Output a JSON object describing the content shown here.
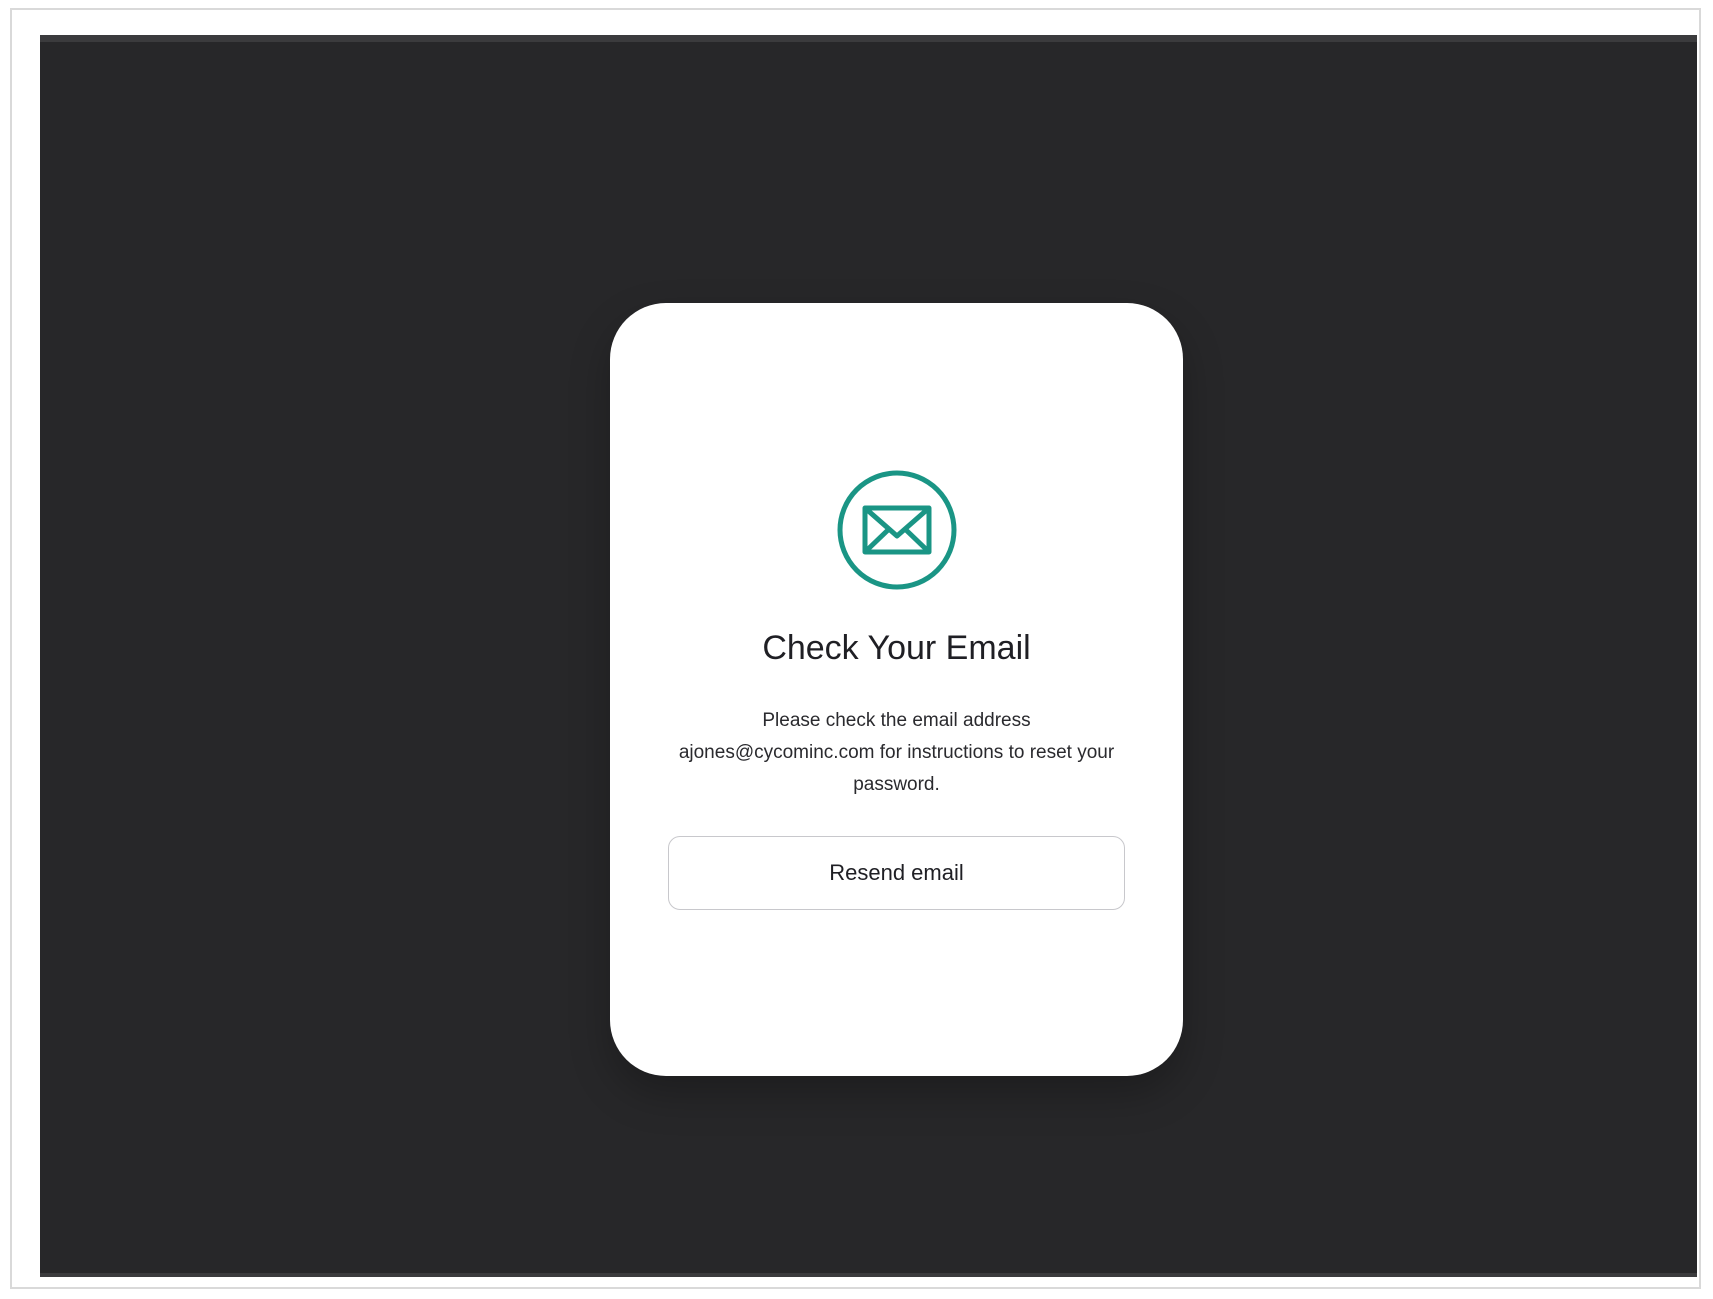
{
  "card": {
    "icon": "envelope-icon",
    "title": "Check Your Email",
    "message": "Please check the email address ajones@cycominc.com for instructions to reset your password.",
    "resend_label": "Resend email"
  },
  "colors": {
    "accent": "#1a9585",
    "background": "#272729",
    "card": "#ffffff",
    "text": "#1f1f24"
  }
}
